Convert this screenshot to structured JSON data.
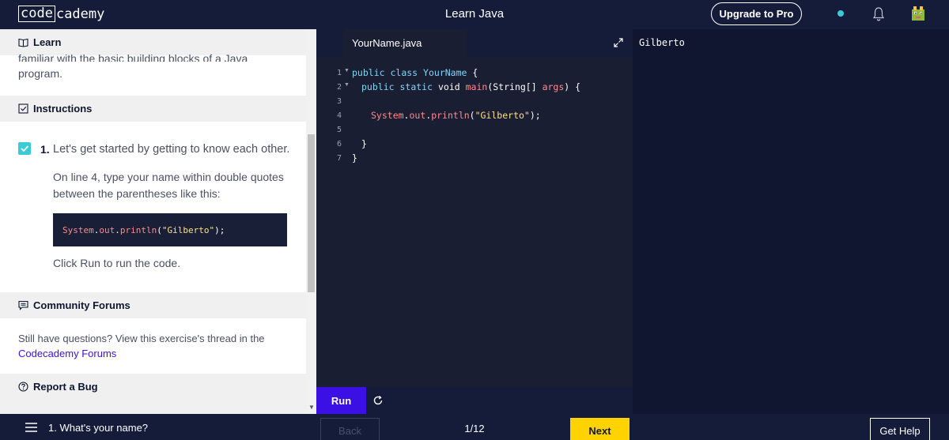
{
  "header": {
    "logo_left": "code",
    "logo_right": "cademy",
    "title": "Learn Java",
    "upgrade_label": "Upgrade to Pro",
    "status_color": "#3ccad6"
  },
  "left_panel": {
    "learn_label": "Learn",
    "intro_text_cut": "familiar with the basic building blocks of a Java",
    "intro_text_end": "program.",
    "instructions_label": "Instructions",
    "task_number": "1.",
    "task_title": "Let's get started by getting to know each other.",
    "task_body_1": "On line 4, type your name within double quotes",
    "task_body_2": "between the parentheses like this:",
    "snippet": {
      "obj": "System",
      "dot1": ".",
      "field": "out",
      "dot2": ".",
      "method": "println",
      "open": "(",
      "str": "\"Gilberto\"",
      "close": ");"
    },
    "run_hint": "Click Run to run the code.",
    "forums_label": "Community Forums",
    "forums_text": "Still have questions? View this exercise's thread in the",
    "forums_link": "Codecademy Forums",
    "bug_label": "Report a Bug",
    "checkbox_checked": true
  },
  "editor": {
    "file_tab": "YourName.java",
    "line_numbers": [
      "1",
      "2",
      "3",
      "4",
      "5",
      "6",
      "7"
    ],
    "lines": {
      "l1": {
        "kw1": "public",
        "kw2": "class",
        "name": "YourName",
        "rest": " {"
      },
      "l2": {
        "kw1": "public",
        "kw2": "static",
        "type": "void",
        "method": "main",
        "open": "(",
        "arg_type": "String[]",
        "arg": "args",
        "close": ") {"
      },
      "l4": {
        "obj": "System",
        "dot1": ".",
        "field": "out",
        "dot2": ".",
        "method": "println",
        "open": "(",
        "str": "\"Gilberto\"",
        "close": ");"
      },
      "l6": "}",
      "l7": "}"
    },
    "run_label": "Run"
  },
  "output": {
    "text": "Gilberto"
  },
  "footer": {
    "lesson_title": "1. What's your name?",
    "back_label": "Back",
    "progress": "1/12",
    "next_label": "Next",
    "help_label": "Get Help"
  },
  "colors": {
    "brand_dark": "#141c3a",
    "accent_purple": "#3a10e5",
    "next_yellow": "#ffd300",
    "check_teal": "#3ccad6"
  }
}
